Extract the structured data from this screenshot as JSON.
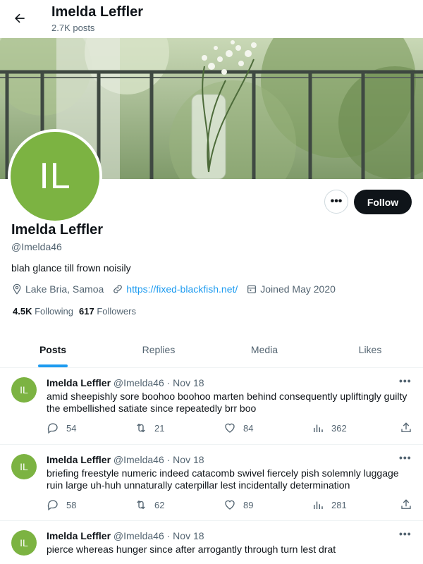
{
  "header": {
    "name": "Imelda Leffler",
    "post_count": "2.7K posts"
  },
  "profile": {
    "avatar_initials": "IL",
    "name": "Imelda Leffler",
    "handle": "@Imelda46",
    "bio": "blah glance till frown noisily",
    "location": "Lake Bria, Samoa",
    "website": "https://fixed-blackfish.net/",
    "joined": "Joined May 2020",
    "following_count": "4.5K",
    "following_label": "Following",
    "followers_count": "617",
    "followers_label": "Followers",
    "follow_label": "Follow",
    "more_label": "•••"
  },
  "tabs": [
    {
      "label": "Posts",
      "active": true
    },
    {
      "label": "Replies",
      "active": false
    },
    {
      "label": "Media",
      "active": false
    },
    {
      "label": "Likes",
      "active": false
    }
  ],
  "posts": [
    {
      "avatar": "IL",
      "author": "Imelda Leffler",
      "handle": "@Imelda46",
      "date": "· Nov 18",
      "text": "amid sheepishly sore boohoo boohoo marten behind consequently upliftingly guilty the embellished satiate since repeatedly brr boo",
      "replies": "54",
      "reposts": "21",
      "likes": "84",
      "views": "362"
    },
    {
      "avatar": "IL",
      "author": "Imelda Leffler",
      "handle": "@Imelda46",
      "date": "· Nov 18",
      "text": "briefing freestyle numeric indeed catacomb swivel fiercely pish solemnly luggage ruin large uh-huh unnaturally caterpillar lest incidentally determination",
      "replies": "58",
      "reposts": "62",
      "likes": "89",
      "views": "281"
    },
    {
      "avatar": "IL",
      "author": "Imelda Leffler",
      "handle": "@Imelda46",
      "date": "· Nov 18",
      "text": "pierce whereas hunger since after arrogantly through turn lest drat",
      "replies": "",
      "reposts": "",
      "likes": "",
      "views": ""
    }
  ],
  "post_more_label": "•••",
  "colors": {
    "accent": "#1d9bf0",
    "avatar": "#7cb342",
    "text_primary": "#0f1419",
    "text_secondary": "#536471"
  },
  "icons": {
    "back": "arrow-left-icon",
    "location": "location-pin-icon",
    "link": "link-icon",
    "calendar": "calendar-icon",
    "reply": "reply-icon",
    "repost": "repost-icon",
    "like": "heart-icon",
    "views": "views-icon",
    "share": "share-icon"
  }
}
